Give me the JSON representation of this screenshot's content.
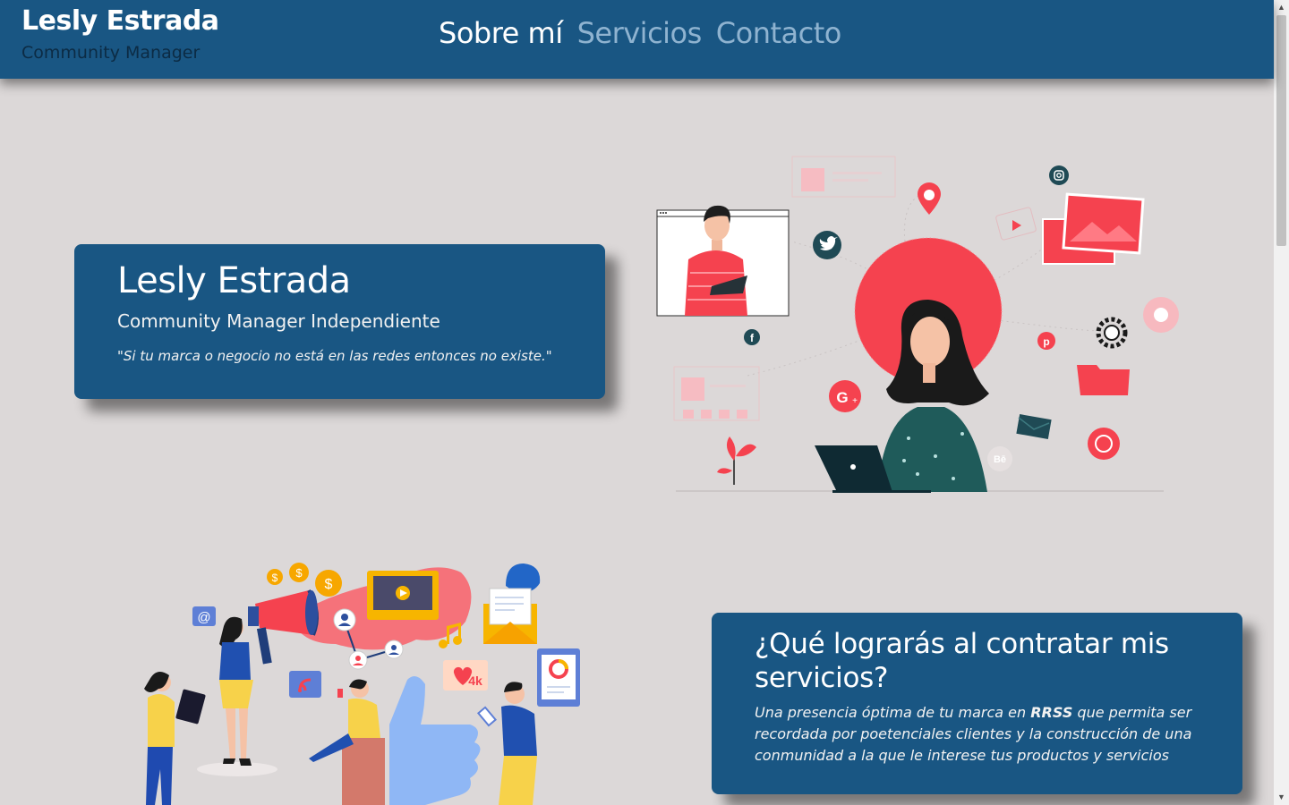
{
  "header": {
    "brand_name": "Lesly Estrada",
    "brand_tagline": "Community Manager",
    "nav": [
      {
        "label": "Sobre mí",
        "active": true
      },
      {
        "label": "Servicios",
        "active": false
      },
      {
        "label": "Contacto",
        "active": false
      }
    ]
  },
  "hero": {
    "title": "Lesly Estrada",
    "subtitle": "Community Manager Independiente",
    "quote": "\"Si tu marca o negocio no está en las redes entonces no existe.\""
  },
  "benefits": {
    "title": "¿Qué lograrás al contratar mis servicios?",
    "body_before": "Una presencia óptima de tu marca en ",
    "body_emphasis": "RRSS",
    "body_after": " que permita ser recordada por poetenciales clientes y la construcción de una conmunidad a la que le interese tus productos y servicios"
  },
  "illustrations": {
    "hero_icons": [
      "twitter-icon",
      "instagram-icon",
      "facebook-icon",
      "pinterest-icon",
      "google-plus-icon",
      "whatsapp-icon",
      "behance-icon",
      "location-pin-icon",
      "gear-icon",
      "folder-icon",
      "envelope-icon"
    ],
    "marketing_icons": [
      "megaphone-icon",
      "coin-icon",
      "video-player-icon",
      "thumbs-up-icon",
      "heart-icon",
      "music-note-icon",
      "rss-icon",
      "at-sign-icon",
      "chart-icon"
    ],
    "marketing_heart_label": "4k"
  },
  "colors": {
    "header_bg": "#195683",
    "page_bg": "#dcd8d8",
    "accent_red": "#f5424f",
    "nav_inactive": "#8fb3d0"
  }
}
